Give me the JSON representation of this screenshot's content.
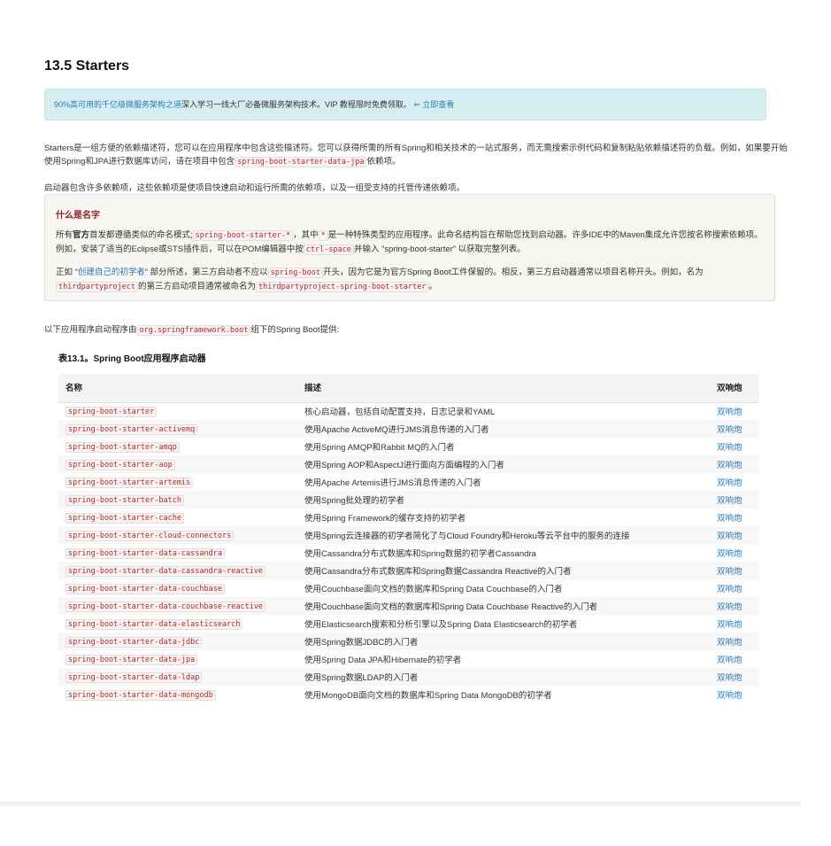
{
  "section": {
    "title": "13.5 Starters"
  },
  "promo": {
    "link_text": "90%高可用的千亿级微服务架构之道",
    "text": "深入学习一线大厂必备微服务架构技术。VIP 教程限时免费领取。",
    "cta": "⇐ 立即查看"
  },
  "intro": {
    "p1_before": "Starters是一组方便的依赖描述符，您可以在应用程序中包含这些描述符。您可以获得所需的所有Spring和相关技术的一站式服务，而无需搜索示例代码和复制粘贴依赖描述符的负载。例如，如果要开始使用Spring和JPA进行数据库访问，请在项目中包含",
    "p1_code": "spring-boot-starter-data-jpa",
    "p1_after": "依赖项。",
    "p2": "启动器包含许多依赖项，这些依赖项是使项目快速启动和运行所需的依赖项，以及一组受支持的托管传递依赖项。"
  },
  "note": {
    "title": "什么是名字",
    "a_1": "所有",
    "a_bold": "官方",
    "a_2": "首发都遵循类似的命名模式;",
    "a_code1": "spring-boot-starter-*",
    "a_3": "，其中",
    "a_code2": "*",
    "a_4": "是一种特殊类型的应用程序。此命名结构旨在帮助您找到启动器。许多IDE中的Maven集成允许您按名称搜索依赖项。例如，安装了适当的Eclipse或STS插件后，可以在POM编辑器中按",
    "a_code3": "ctrl-space",
    "a_5": "并输入 “spring-boot-starter” 以获取完整列表。",
    "b_1": "正如 “",
    "b_link": "创建自己的初学者",
    "b_2": "” 部分所述，第三方启动者不应以",
    "b_code1": "spring-boot",
    "b_3": "开头，因为它是为官方Spring Boot工件保留的。相反，第三方启动器通常以项目名称开头。例如，名为",
    "b_code2": "thirdpartyproject",
    "b_4": "的第三方启动项目通常被命名为",
    "b_code3": "thirdpartyproject-spring-boot-starter",
    "b_5": "。"
  },
  "provided": {
    "before": "以下应用程序启动程序由",
    "code": "org.springframework.boot",
    "after": "组下的Spring Boot提供:"
  },
  "table": {
    "caption": "表13.1。Spring Boot应用程序启动器",
    "headers": [
      "名称",
      "描述",
      "双响炮"
    ],
    "rows": [
      {
        "name": "spring-boot-starter",
        "desc": "核心启动器，包括自动配置支持，日志记录和YAML",
        "pom": "双响炮"
      },
      {
        "name": "spring-boot-starter-activemq",
        "desc": "使用Apache ActiveMQ进行JMS消息传递的入门者",
        "pom": "双响炮"
      },
      {
        "name": "spring-boot-starter-amqp",
        "desc": "使用Spring AMQP和Rabbit MQ的入门者",
        "pom": "双响炮"
      },
      {
        "name": "spring-boot-starter-aop",
        "desc": "使用Spring AOP和AspectJ进行面向方面编程的入门者",
        "pom": "双响炮"
      },
      {
        "name": "spring-boot-starter-artemis",
        "desc": "使用Apache Artemis进行JMS消息传递的入门者",
        "pom": "双响炮"
      },
      {
        "name": "spring-boot-starter-batch",
        "desc": "使用Spring批处理的初学者",
        "pom": "双响炮"
      },
      {
        "name": "spring-boot-starter-cache",
        "desc": "使用Spring Framework的缓存支持的初学者",
        "pom": "双响炮"
      },
      {
        "name": "spring-boot-starter-cloud-connectors",
        "desc": "使用Spring云连接器的初学者简化了与Cloud Foundry和Heroku等云平台中的服务的连接",
        "pom": "双响炮"
      },
      {
        "name": "spring-boot-starter-data-cassandra",
        "desc": "使用Cassandra分布式数据库和Spring数据的初学者Cassandra",
        "pom": "双响炮"
      },
      {
        "name": "spring-boot-starter-data-cassandra-reactive",
        "desc": "使用Cassandra分布式数据库和Spring数据Cassandra Reactive的入门者",
        "pom": "双响炮"
      },
      {
        "name": "spring-boot-starter-data-couchbase",
        "desc": "使用Couchbase面向文档的数据库和Spring Data Couchbase的入门者",
        "pom": "双响炮"
      },
      {
        "name": "spring-boot-starter-data-couchbase-reactive",
        "desc": "使用Couchbase面向文档的数据库和Spring Data Couchbase Reactive的入门者",
        "pom": "双响炮"
      },
      {
        "name": "spring-boot-starter-data-elasticsearch",
        "desc": "使用Elasticsearch搜索和分析引擎以及Spring Data Elasticsearch的初学者",
        "pom": "双响炮"
      },
      {
        "name": "spring-boot-starter-data-jdbc",
        "desc": "使用Spring数据JDBC的入门者",
        "pom": "双响炮"
      },
      {
        "name": "spring-boot-starter-data-jpa",
        "desc": "使用Spring Data JPA和Hibernate的初学者",
        "pom": "双响炮"
      },
      {
        "name": "spring-boot-starter-data-ldap",
        "desc": "使用Spring数据LDAP的入门者",
        "pom": "双响炮"
      },
      {
        "name": "spring-boot-starter-data-mongodb",
        "desc": "使用MongoDB面向文档的数据库和Spring Data MongoDB的初学者",
        "pom": "双响炮"
      }
    ]
  }
}
